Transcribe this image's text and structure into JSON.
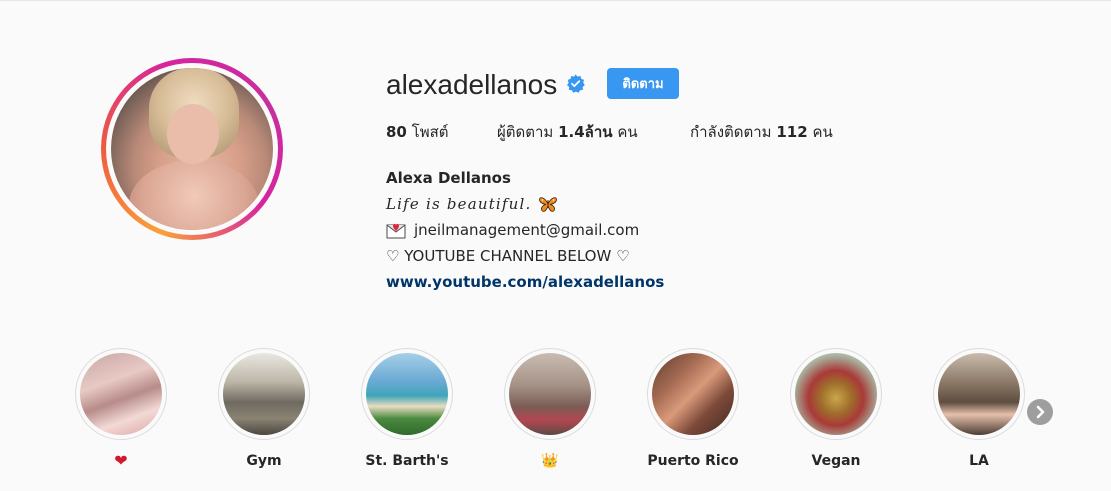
{
  "profile": {
    "username": "alexadellanos",
    "follow_label": "ติดตาม",
    "stats": {
      "posts_count": "80",
      "posts_label": "โพสต์",
      "followers_label": "ผู้ติดตาม",
      "followers_count": "1.4ล้าน",
      "followers_unit": "คน",
      "following_label": "กำลังติดตาม",
      "following_count": "112",
      "following_unit": "คน"
    },
    "bio": {
      "full_name": "Alexa Dellanos",
      "quote": "Life is beautiful.",
      "email": "jneilmanagement@gmail.com",
      "youtube_line": "♡ YOUTUBE CHANNEL BELOW ♡",
      "link": "www.youtube.com/alexadellanos"
    },
    "icons": {
      "verified": "verified-badge-icon",
      "butterfly": "butterfly-icon",
      "mail": "love-letter-icon"
    }
  },
  "highlights": [
    {
      "label": "❤",
      "icon": "heart-icon"
    },
    {
      "label": "Gym"
    },
    {
      "label": "St. Barth's"
    },
    {
      "label": "👑",
      "icon": "crown-icon"
    },
    {
      "label": "Puerto Rico"
    },
    {
      "label": "Vegan"
    },
    {
      "label": "LA"
    }
  ],
  "colors": {
    "follow_button": "#3897f0",
    "link": "#003569",
    "text": "#262626",
    "background": "#fafafa",
    "verified": "#3897f0"
  }
}
